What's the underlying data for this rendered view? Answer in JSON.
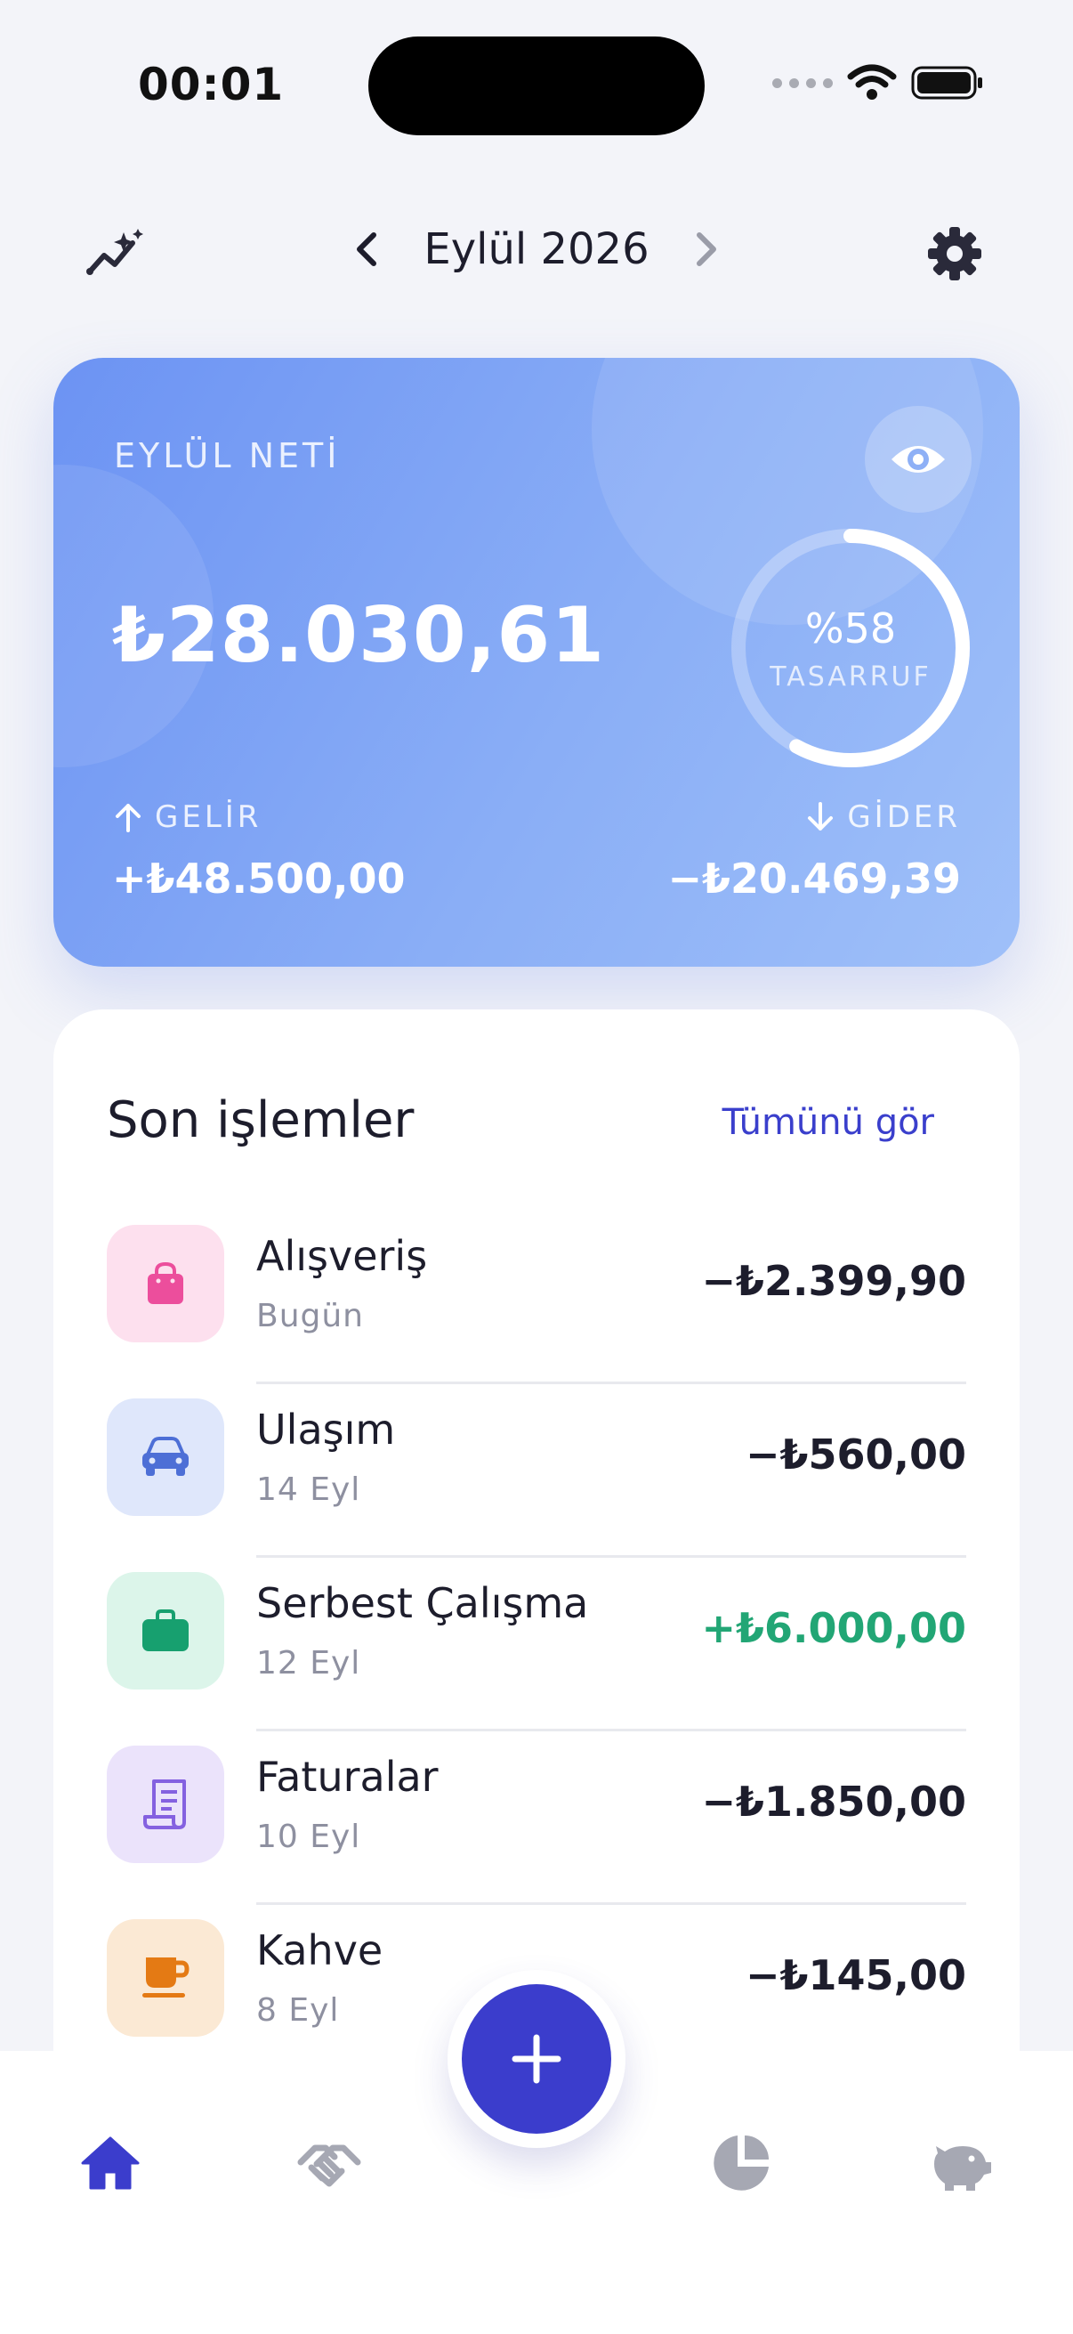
{
  "status_bar": {
    "time": "00:01"
  },
  "header": {
    "month": "Eylül 2026"
  },
  "summary": {
    "label": "EYLÜL NETİ",
    "net": "₺28.030,61",
    "savings_pct_text": "%58",
    "savings_fraction": 0.58,
    "savings_label": "TASARRUF",
    "income_label": "GELİR",
    "income": "+₺48.500,00",
    "expense_label": "GİDER",
    "expense": "−₺20.469,39"
  },
  "transactions": {
    "title": "Son işlemler",
    "see_all": "Tümünü gör",
    "items": [
      {
        "name": "Alışveriş",
        "date": "Bugün",
        "amount": "−₺2.399,90",
        "icon": "shopping-bag-icon",
        "icon_bg": "#fde0ee",
        "icon_color": "#ec4e9c"
      },
      {
        "name": "Ulaşım",
        "date": "14 Eyl",
        "amount": "−₺560,00",
        "icon": "car-icon",
        "icon_bg": "#dfe7fb",
        "icon_color": "#4d6fd6"
      },
      {
        "name": "Serbest Çalışma",
        "date": "12 Eyl",
        "amount": "+₺6.000,00",
        "icon": "briefcase-icon",
        "icon_bg": "#dcf5ea",
        "icon_color": "#17a06f"
      },
      {
        "name": "Faturalar",
        "date": "10 Eyl",
        "amount": "−₺1.850,00",
        "icon": "receipt-icon",
        "icon_bg": "#ebe3fb",
        "icon_color": "#8461e0"
      },
      {
        "name": "Kahve",
        "date": "8 Eyl",
        "amount": "−₺145,00",
        "icon": "coffee-cup-icon",
        "icon_bg": "#fbe9d4",
        "icon_color": "#e47a14"
      }
    ]
  },
  "colors": {
    "accent": "#3b3dcc",
    "positive": "#22a675",
    "inactive": "#a6a8b3"
  }
}
